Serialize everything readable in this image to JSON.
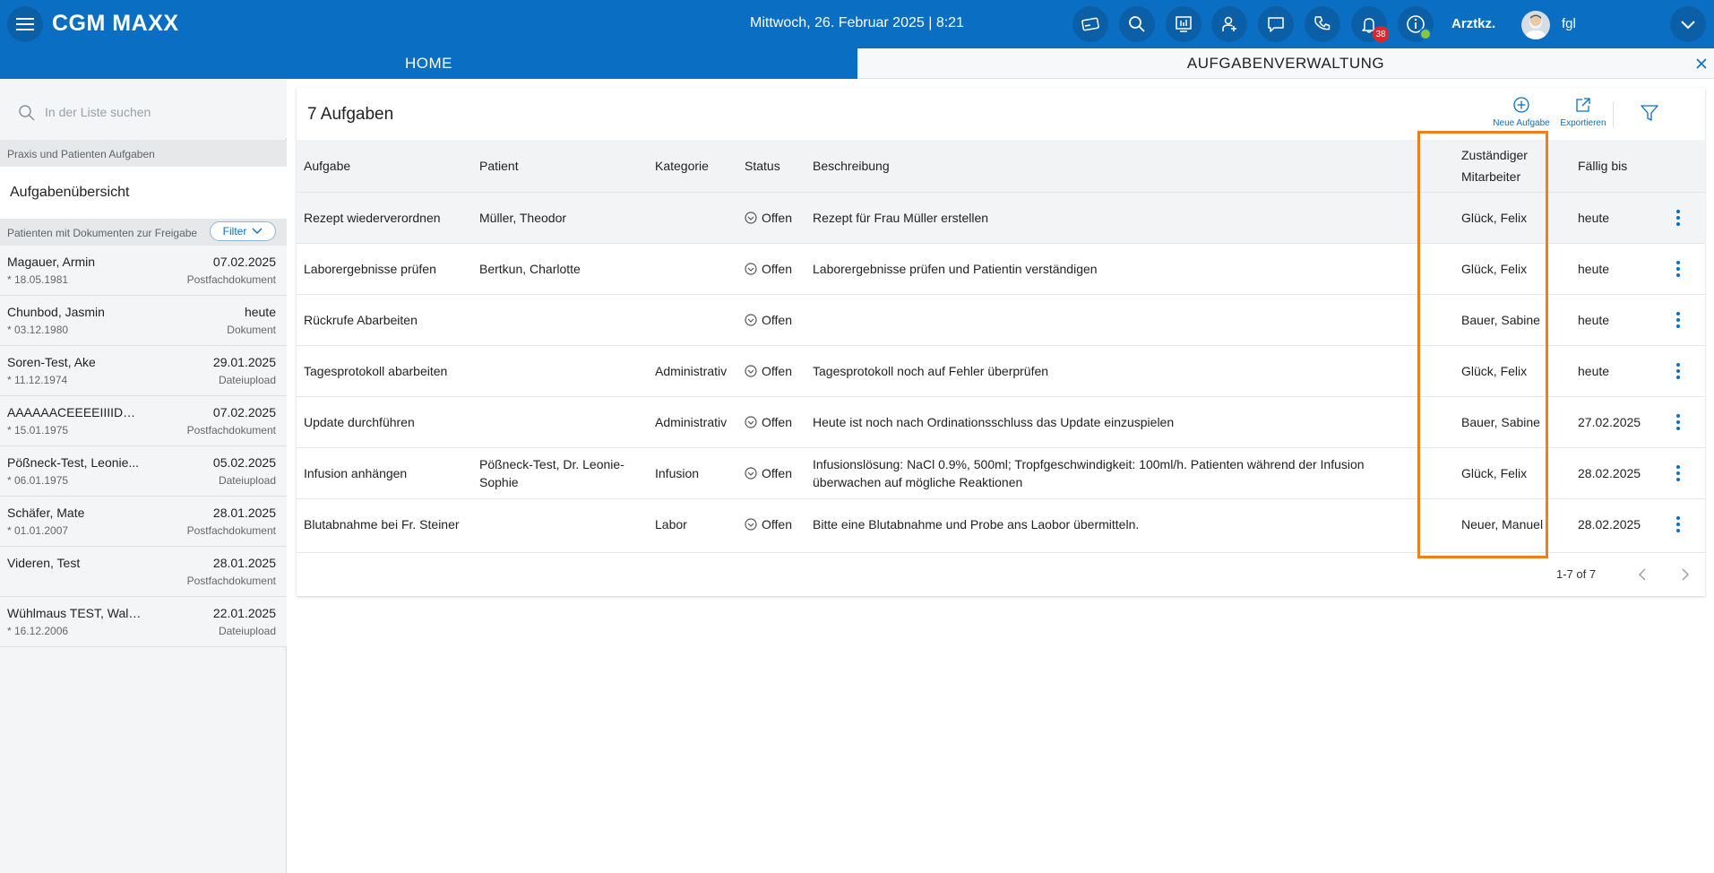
{
  "header": {
    "app_title": "CGM MAXX",
    "datetime": "Mittwoch, 26. Februar 2025 | 8:21",
    "notification_count": "38",
    "arztkz_label": "Arztkz.",
    "user_name": "fgl",
    "icons": [
      "card-icon",
      "search-icon",
      "monitor-chart-icon",
      "person-add-icon",
      "chat-icon",
      "phone-icon",
      "bell-icon",
      "info-icon"
    ],
    "bar_color": "#0a6fc2"
  },
  "tabs": {
    "home_label": "HOME",
    "tasks_label": "AUFGABENVERWALTUNG"
  },
  "sidebar": {
    "search_placeholder": "In der Liste suchen",
    "section_tasks_label": "Praxis und Patienten Aufgaben",
    "overview_label": "Aufgabenübersicht",
    "section_docs_label": "Patienten mit Dokumenten zur Freigabe",
    "filter_label": "Filter",
    "patients": [
      {
        "name": "Magauer, Armin",
        "birth": "* 18.05.1981",
        "date": "07.02.2025",
        "type": "Postfachdokument"
      },
      {
        "name": "Chunbod, Jasmin",
        "birth": "* 03.12.1980",
        "date": "heute",
        "type": "Dokument"
      },
      {
        "name": "Soren-Test, Ake",
        "birth": "* 11.12.1974",
        "date": "29.01.2025",
        "type": "Dateiupload"
      },
      {
        "name": "AAAAAACEEEEIIIIDNO...",
        "birth": "* 15.01.1975",
        "date": "07.02.2025",
        "type": "Postfachdokument"
      },
      {
        "name": "Pößneck-Test, Leonie...",
        "birth": "* 06.01.1975",
        "date": "05.02.2025",
        "type": "Dateiupload"
      },
      {
        "name": "Schäfer, Mate",
        "birth": "* 01.01.2007",
        "date": "28.01.2025",
        "type": "Postfachdokument"
      },
      {
        "name": "Videren, Test",
        "birth": "",
        "date": "28.01.2025",
        "type": "Postfachdokument"
      },
      {
        "name": "Wühlmaus TEST, Wald...",
        "birth": "* 16.12.2006",
        "date": "22.01.2025",
        "type": "Dateiupload"
      }
    ]
  },
  "main": {
    "title": "7 Aufgaben",
    "new_task_label": "Neue Aufgabe",
    "export_label": "Exportieren",
    "columns": {
      "task": "Aufgabe",
      "patient": "Patient",
      "category": "Kategorie",
      "status": "Status",
      "description": "Beschreibung",
      "assignee": "Zuständiger Mitarbeiter",
      "due": "Fällig bis"
    },
    "rows": [
      {
        "task": "Rezept wiederverordnen",
        "patient": "Müller, Theodor",
        "category": "",
        "status": "Offen",
        "description": "Rezept für Frau Müller erstellen",
        "assignee": "Glück, Felix",
        "due": "heute"
      },
      {
        "task": "Laborergebnisse prüfen",
        "patient": "Bertkun, Charlotte",
        "category": "",
        "status": "Offen",
        "description": "Laborergebnisse prüfen und Patientin verständigen",
        "assignee": "Glück, Felix",
        "due": "heute"
      },
      {
        "task": "Rückrufe Abarbeiten",
        "patient": "",
        "category": "",
        "status": "Offen",
        "description": "",
        "assignee": "Bauer, Sabine",
        "due": "heute"
      },
      {
        "task": "Tagesprotokoll abarbeiten",
        "patient": "",
        "category": "Administrativ",
        "status": "Offen",
        "description": "Tagesprotokoll noch auf Fehler überprüfen",
        "assignee": "Glück, Felix",
        "due": "heute"
      },
      {
        "task": "Update durchführen",
        "patient": "",
        "category": "Administrativ",
        "status": "Offen",
        "description": "Heute ist noch nach Ordinationsschluss das Update einzuspielen",
        "assignee": "Bauer, Sabine",
        "due": "27.02.2025"
      },
      {
        "task": "Infusion anhängen",
        "patient": "Pößneck-Test, Dr. Leonie-Sophie",
        "category": "Infusion",
        "status": "Offen",
        "description": "Infusionslösung: NaCl 0.9%, 500ml; Tropfgeschwindigkeit: 100ml/h. Patienten während der Infusion überwachen auf mögliche Reaktionen",
        "assignee": "Glück, Felix",
        "due": "28.02.2025"
      },
      {
        "task": "Blutabnahme bei Fr. Steiner",
        "patient": "",
        "category": "Labor",
        "status": "Offen",
        "description": "Bitte eine Blutabnahme und Probe ans Laobor übermitteln.",
        "assignee": "Neuer, Manuel",
        "due": "28.02.2025"
      }
    ],
    "pagination": "1-7 of 7",
    "highlight_color": "#f07f1a"
  }
}
